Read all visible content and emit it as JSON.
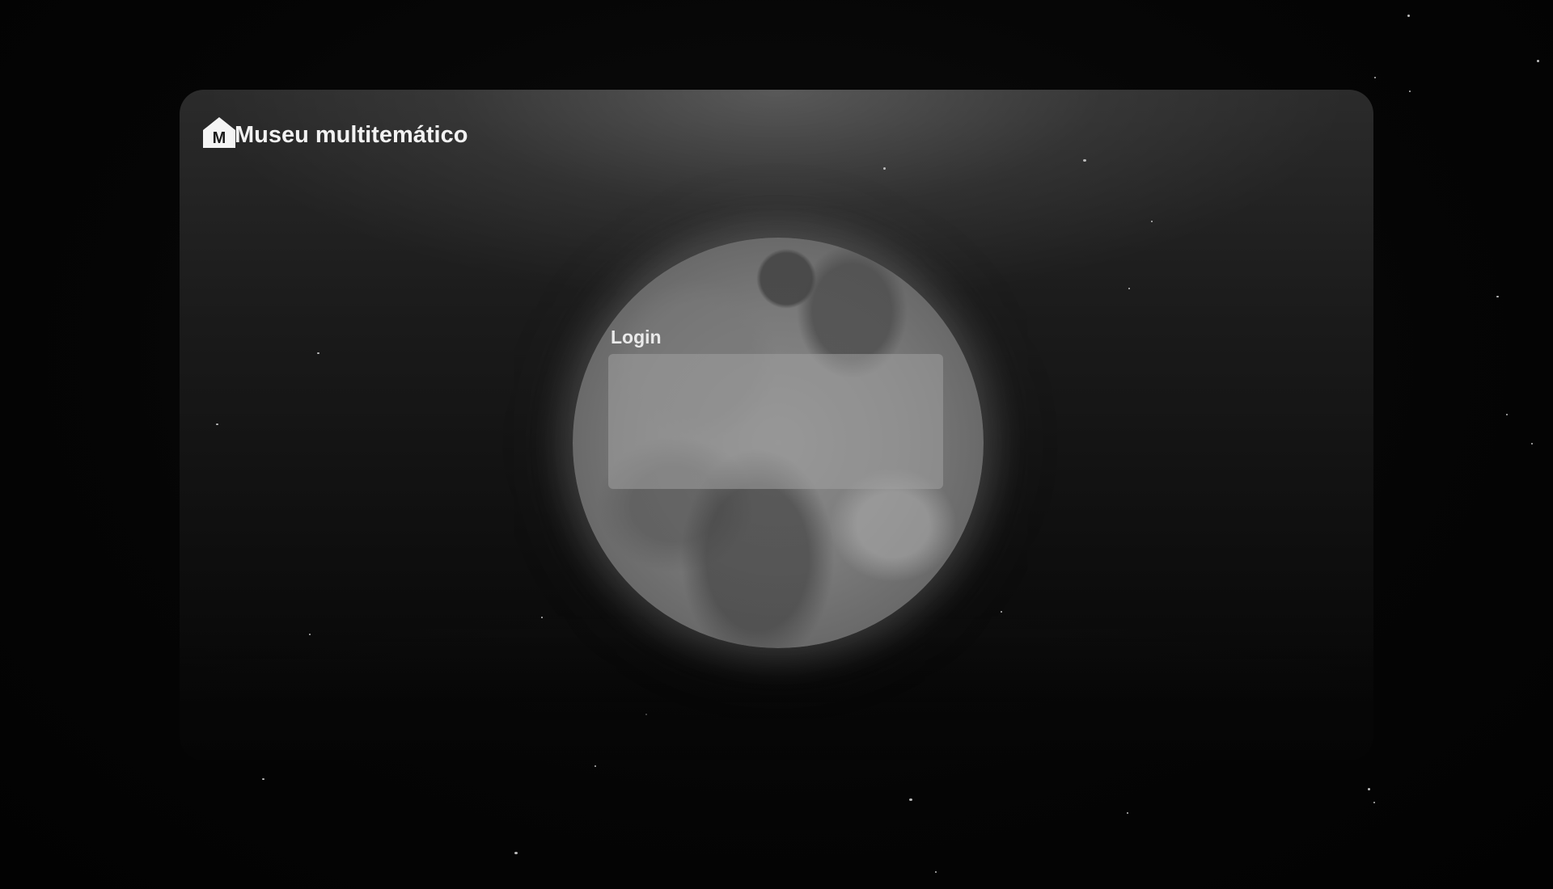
{
  "brand": {
    "title": "Museu multitemático",
    "logo_letter": "M",
    "logo_icon": "museum-house-icon"
  },
  "login": {
    "label": "Login"
  },
  "colors": {
    "background": "#050505",
    "card_top": "#2b2b2b",
    "text": "#f2f2f2",
    "login_panel": "#a0a0a0"
  }
}
